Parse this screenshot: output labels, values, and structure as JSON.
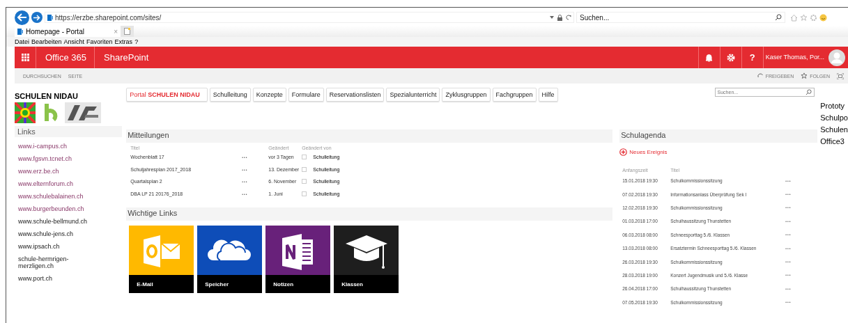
{
  "browser": {
    "url": "https://erzbe.sharepoint.com/sites/",
    "search_placeholder": "Suchen...",
    "tab_title": "Homepage - Portal",
    "tab_close": "×",
    "menu": [
      "Datei",
      "Bearbeiten",
      "Ansicht",
      "Favoriten",
      "Extras",
      "?"
    ]
  },
  "suitebar": {
    "office": "Office 365",
    "app": "SharePoint",
    "help": "?",
    "user": "Kaser Thomas, Por..."
  },
  "ribbon": {
    "left": [
      "DURCHSUCHEN",
      "SEITE"
    ],
    "share": "FREIGEBEN",
    "follow": "FOLGEN"
  },
  "site": {
    "title": "SCHULEN NIDAU",
    "search_placeholder": "Suchen..."
  },
  "nav": [
    {
      "label": "Portal **SCHULEN NIDAU**",
      "selected": true
    },
    {
      "label": "Schulleitung",
      "selected": false
    },
    {
      "label": "Konzepte",
      "selected": false
    },
    {
      "label": "Formulare",
      "selected": false
    },
    {
      "label": "Reservationslisten",
      "selected": false
    },
    {
      "label": "Spezialunterricht",
      "selected": false
    },
    {
      "label": "Zyklusgruppen",
      "selected": false
    },
    {
      "label": "Fachgruppen",
      "selected": false
    },
    {
      "label": "Hilfe",
      "selected": false
    }
  ],
  "links": {
    "title": "Links",
    "items": [
      {
        "label": "www.i-campus.ch",
        "visited": true
      },
      {
        "label": "www.fgsvn.tcnet.ch",
        "visited": true
      },
      {
        "label": "www.erz.be.ch",
        "visited": true
      },
      {
        "label": "www.elternforum.ch",
        "visited": true
      },
      {
        "label": "www.schulebalainen.ch",
        "visited": true
      },
      {
        "label": "www.burgerbeunden.ch",
        "visited": true
      },
      {
        "label": "www.schule-bellmund.ch",
        "visited": false
      },
      {
        "label": "www.schule-jens.ch",
        "visited": false
      },
      {
        "label": "www.ipsach.ch",
        "visited": false
      },
      {
        "label": "schule-hermrigen-merzligen.ch",
        "visited": false
      },
      {
        "label": "www.port.ch",
        "visited": false
      }
    ]
  },
  "mitteilungen": {
    "title": "Mitteilungen",
    "columns": [
      "Titel",
      "Geändert",
      "Geändert von"
    ],
    "more": "•••",
    "rows": [
      {
        "title": "Wochenblatt 17",
        "changed": "vor 3 Tagen",
        "checked": false,
        "by": "Schulleitung"
      },
      {
        "title": "Schuljahresplan 2017_2018",
        "changed": "13. Dezember",
        "checked": false,
        "by": "Schulleitung"
      },
      {
        "title": "Quartalsplan 2",
        "changed": "6. November",
        "checked": false,
        "by": "Schulleitung"
      },
      {
        "title": "DBA LP 21 20176_2018",
        "changed": "1. Juni",
        "checked": false,
        "by": "Schulleitung"
      }
    ]
  },
  "wichtige_links": {
    "title": "Wichtige Links",
    "tiles": [
      {
        "label": "E-Mail",
        "kind": "mail",
        "color": "#ffb900"
      },
      {
        "label": "Speicher",
        "kind": "cloud",
        "color": "#0e4db8"
      },
      {
        "label": "Notizen",
        "kind": "notes",
        "color": "#68217a"
      },
      {
        "label": "Klassen",
        "kind": "classes",
        "color": "#1e1e1e"
      }
    ]
  },
  "agenda": {
    "title": "Schulagenda",
    "new_event": "Neues Ereignis",
    "columns": [
      "Anfangszeit",
      "Titel"
    ],
    "more": "•••",
    "rows": [
      {
        "start": "15.01.2018 19:30",
        "title": "Schulkommissionssitzung"
      },
      {
        "start": "07.02.2018 19:30",
        "title": "Informationsanlass Überprüfung Sek I"
      },
      {
        "start": "12.02.2018 19:30",
        "title": "Schulkommissionssitzung"
      },
      {
        "start": "01.03.2018 17:00",
        "title": "Schulhaussitzung Thunstetten"
      },
      {
        "start": "06.03.2018 08:00",
        "title": "Schneesporttag 5./6. Klassen"
      },
      {
        "start": "13.03.2018 08:00",
        "title": "Ersatztermin Schneesporttag 5./6. Klassen"
      },
      {
        "start": "26.03.2018 19:30",
        "title": "Schulkommissionssitzung"
      },
      {
        "start": "28.03.2018 19:00",
        "title": "Konzert Jugendmusik und 5./6. Klasse"
      },
      {
        "start": "26.04.2018 17:00",
        "title": "Schulhaussitzung Thunstetten"
      },
      {
        "start": "07.05.2018 19:30",
        "title": "Schulkommissionssitzung"
      }
    ]
  },
  "side_note": [
    "Prototy",
    "Schulpo",
    "Schulen",
    "Office3"
  ]
}
